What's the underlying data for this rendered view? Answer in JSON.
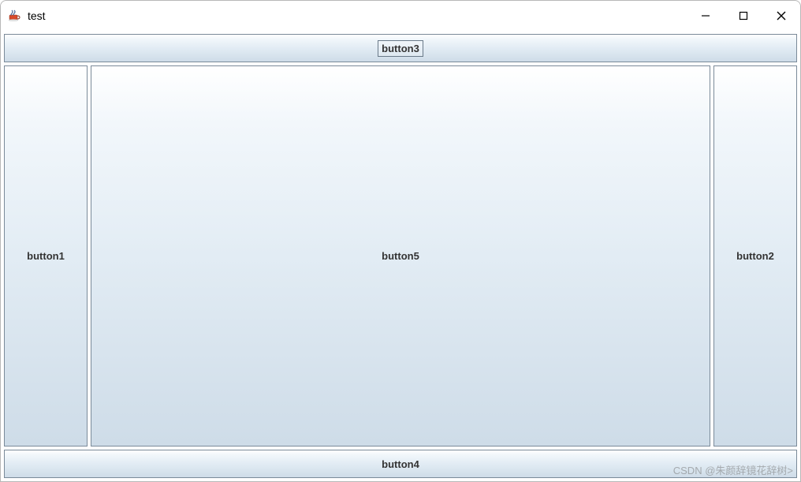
{
  "window": {
    "title": "test"
  },
  "buttons": {
    "north": "button3",
    "south": "button4",
    "west": "button1",
    "east": "button2",
    "center": "button5"
  },
  "watermark": "CSDN @朱颜辞镜花辞树>"
}
